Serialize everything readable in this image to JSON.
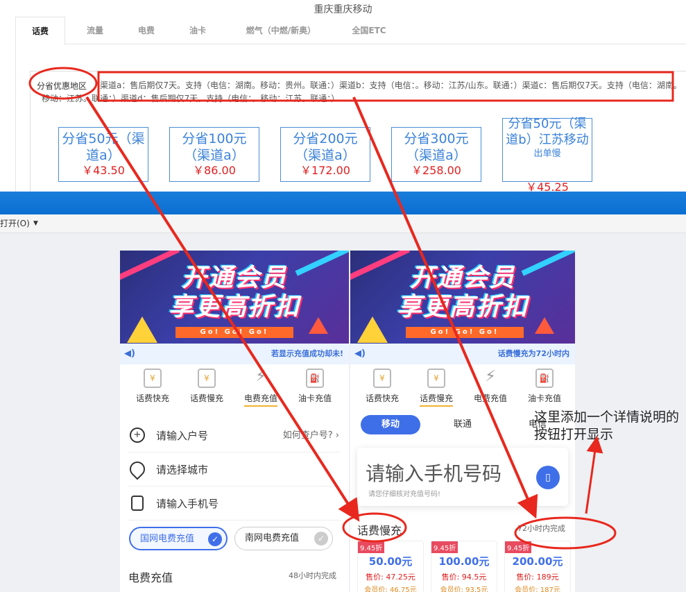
{
  "header": {
    "title": "重庆重庆移动"
  },
  "tabs": [
    {
      "label": "话费",
      "active": true
    },
    {
      "label": "流量"
    },
    {
      "label": "电费"
    },
    {
      "label": "油卡"
    },
    {
      "label": "燃气（中燃/新奥）"
    },
    {
      "label": "全国ETC"
    }
  ],
  "region_label": "分省优惠地区",
  "channel_notice": "渠道a：售后期仅7天。支持（电信：湖南。移动：贵州。联通：）渠道b：支持（电信：。移动：江苏/山东。联通：）渠道c：售后期仅7天。支持（电信：湖南。移动：江苏。联通：）渠道d：售后期仅7天。支持（电信：。移动：江苏。联通：）",
  "products": [
    {
      "name": "分省50元（渠道a）",
      "price": "￥43.50",
      "note": ""
    },
    {
      "name": "分省100元（渠道a）",
      "price": "￥86.00",
      "note": ""
    },
    {
      "name": "分省200元（渠道a）",
      "price": "￥172.00",
      "note": ""
    },
    {
      "name": "分省300元（渠道a）",
      "price": "￥258.00",
      "note": ""
    },
    {
      "name": "分省50元（渠道b）江苏移动",
      "price": "￥45.25",
      "note": "出单慢"
    }
  ],
  "menubar": {
    "open_label": "打开(O)"
  },
  "phone_left": {
    "banner_line1": "开通会员",
    "banner_line2": "享更高折扣",
    "banner_go": "Go! Go! Go!",
    "marquee": "若显示充值成功却未!",
    "categories": [
      "话费快充",
      "话费慢充",
      "电费充值",
      "油卡充值"
    ],
    "category_icons": [
      "phone-bill-icon",
      "phone-bill-icon",
      "lightning-icon",
      "fuel-icon"
    ],
    "selected_category": 2,
    "rows": [
      {
        "icon": "plus-circle-icon",
        "text": "请输入户号",
        "right": "如何查户号?"
      },
      {
        "icon": "location-icon",
        "text": "请选择城市",
        "right": ""
      },
      {
        "icon": "mobile-icon",
        "text": "请输入手机号",
        "right": ""
      }
    ],
    "grid_options": [
      {
        "label": "国网电费充值",
        "selected": true
      },
      {
        "label": "南网电费充值",
        "selected": false
      }
    ],
    "section_title": "电费充值",
    "section_right": "48小时内完成"
  },
  "phone_right": {
    "banner_line1": "开通会员",
    "banner_line2": "享更高折扣",
    "banner_go": "Go! Go! Go!",
    "marquee": "话费慢充为72小时内",
    "categories": [
      "话费快充",
      "话费慢充",
      "电费充值",
      "油卡充值"
    ],
    "category_icons": [
      "phone-bill-icon",
      "phone-bill-icon",
      "lightning-icon",
      "fuel-icon"
    ],
    "selected_category": 1,
    "operators": [
      "移动",
      "联通",
      "电信"
    ],
    "phone_placeholder": "请输入手机号码",
    "phone_hint": "请您仔细核对充值号码!",
    "section_title": "话费慢充",
    "section_right": "72小时内完成",
    "cards": [
      {
        "discount": "9.45折",
        "face": "50.00元",
        "sale": "售价: 47.25元",
        "member": "会员价: 46.75元"
      },
      {
        "discount": "9.45折",
        "face": "100.00元",
        "sale": "售价: 94.5元",
        "member": "会员价: 93.5元"
      },
      {
        "discount": "9.45折",
        "face": "200.00元",
        "sale": "售价: 189元",
        "member": "会员价: 187元"
      }
    ]
  },
  "annotation": {
    "text": "这里添加一个详情说明的按钮打开显示"
  },
  "colors": {
    "accent_blue": "#3f6fe8",
    "price_red": "#e02020",
    "annot_red": "#e8281e",
    "window_blue": "#0b6fd2"
  }
}
